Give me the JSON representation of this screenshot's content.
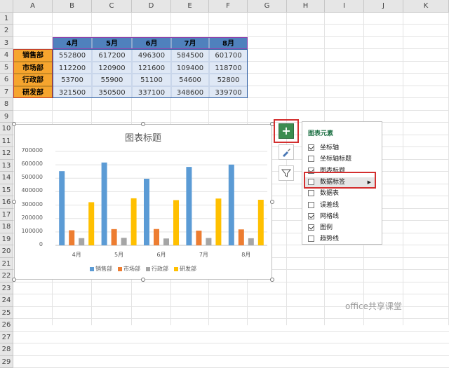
{
  "columns": [
    "A",
    "B",
    "C",
    "D",
    "E",
    "F",
    "G",
    "H",
    "I",
    "J",
    "K"
  ],
  "rows": [
    "1",
    "2",
    "3",
    "4",
    "5",
    "6",
    "7",
    "8",
    "9",
    "10",
    "11",
    "12",
    "13",
    "14",
    "15",
    "16",
    "17",
    "18",
    "19",
    "20",
    "21",
    "22",
    "23",
    "24",
    "25",
    "26",
    "27",
    "28",
    "29"
  ],
  "table": {
    "headers": [
      "4月",
      "5月",
      "6月",
      "7月",
      "8月"
    ],
    "rows": [
      {
        "label": "销售部",
        "values": [
          "552800",
          "617200",
          "496300",
          "584500",
          "601700"
        ]
      },
      {
        "label": "市场部",
        "values": [
          "112200",
          "120900",
          "121600",
          "109400",
          "118700"
        ]
      },
      {
        "label": "行政部",
        "values": [
          "53700",
          "55900",
          "51100",
          "54600",
          "52800"
        ]
      },
      {
        "label": "研发部",
        "values": [
          "321500",
          "350500",
          "337100",
          "348600",
          "339700"
        ]
      }
    ]
  },
  "chart_data": {
    "type": "bar",
    "title": "图表标题",
    "categories": [
      "4月",
      "5月",
      "6月",
      "7月",
      "8月"
    ],
    "series": [
      {
        "name": "销售部",
        "color": "#5b9bd5",
        "values": [
          552800,
          617200,
          496300,
          584500,
          601700
        ]
      },
      {
        "name": "市场部",
        "color": "#ed7d31",
        "values": [
          112200,
          120900,
          121600,
          109400,
          118700
        ]
      },
      {
        "name": "行政部",
        "color": "#a5a5a5",
        "values": [
          53700,
          55900,
          51100,
          54600,
          52800
        ]
      },
      {
        "name": "研发部",
        "color": "#ffc000",
        "values": [
          321500,
          350500,
          337100,
          348600,
          339700
        ]
      }
    ],
    "ylim": [
      0,
      700000
    ],
    "yticks": [
      "700000",
      "600000",
      "500000",
      "400000",
      "300000",
      "200000",
      "100000",
      "0"
    ],
    "grid": true,
    "legend": "bottom"
  },
  "panel": {
    "title": "图表元素",
    "items": [
      {
        "label": "坐标轴",
        "checked": true
      },
      {
        "label": "坐标轴标题",
        "checked": false
      },
      {
        "label": "图表标题",
        "checked": true
      },
      {
        "label": "数据标签",
        "checked": false
      },
      {
        "label": "数据表",
        "checked": false
      },
      {
        "label": "误差线",
        "checked": false
      },
      {
        "label": "网格线",
        "checked": true
      },
      {
        "label": "图例",
        "checked": true
      },
      {
        "label": "趋势线",
        "checked": false
      }
    ],
    "submenu_arrow": "▶"
  },
  "side_buttons": {
    "add": "+",
    "style_icon": "brush-icon",
    "filter_icon": "filter-icon"
  },
  "watermark": "office共享课堂",
  "colors": {
    "header_blue": "#4f81bd",
    "label_orange": "#f6a52e",
    "value_fill": "#dfe8f5",
    "highlight_red": "#d32f2f",
    "add_green": "#3c8c50"
  }
}
